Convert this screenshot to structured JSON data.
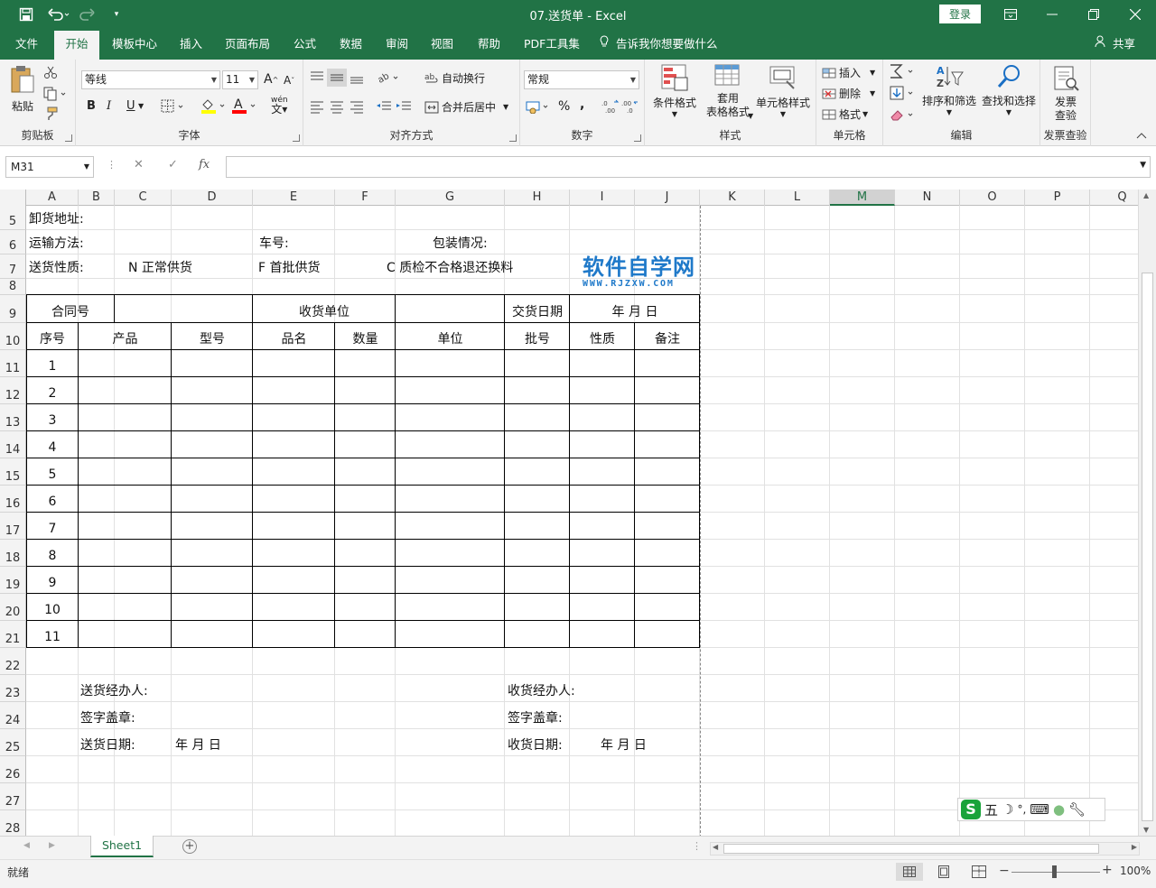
{
  "titlebar": {
    "title": "07.送货单  -  Excel",
    "login_label": "登录"
  },
  "menu": {
    "tabs": [
      "文件",
      "开始",
      "模板中心",
      "插入",
      "页面布局",
      "公式",
      "数据",
      "审阅",
      "视图",
      "帮助",
      "PDF工具集"
    ],
    "active_tab": "开始",
    "tellme": "告诉我你想要做什么",
    "share": "共享"
  },
  "ribbon": {
    "clipboard": {
      "label": "剪贴板",
      "paste": "粘贴"
    },
    "font": {
      "label": "字体",
      "name": "等线",
      "size": "11",
      "bold": "B",
      "italic": "I",
      "underline": "U",
      "wen": "wén"
    },
    "alignment": {
      "label": "对齐方式",
      "wrap": "自动换行",
      "merge": "合并后居中"
    },
    "number": {
      "label": "数字",
      "format": "常规",
      "percent": "%",
      "comma": ","
    },
    "styles": {
      "label": "样式",
      "cond": "条件格式",
      "table_line1": "套用",
      "table_line2": "表格格式",
      "cell": "单元格样式"
    },
    "cells": {
      "label": "单元格",
      "insert": "插入",
      "delete": "删除",
      "format": "格式"
    },
    "editing": {
      "label": "编辑",
      "sort": "排序和筛选",
      "find": "查找和选择"
    },
    "invoice": {
      "label": "发票查验",
      "line1": "发票",
      "line2": "查验"
    }
  },
  "formula": {
    "namebox": "M31",
    "value": ""
  },
  "grid": {
    "columns": [
      "A",
      "B",
      "C",
      "D",
      "E",
      "F",
      "G",
      "H",
      "I",
      "J",
      "K",
      "L",
      "M",
      "N",
      "O",
      "P",
      "Q"
    ],
    "selected_column": "M",
    "rows": [
      "5",
      "6",
      "7",
      "8",
      "9",
      "10",
      "11",
      "12",
      "13",
      "14",
      "15",
      "16",
      "17",
      "18",
      "19",
      "20",
      "21",
      "22",
      "23",
      "24",
      "25",
      "26",
      "27",
      "28"
    ],
    "cells": {
      "unload_address": "卸货地址:",
      "transport": "运输方法:",
      "car_no": "车号:",
      "packing": "包装情况:",
      "nature": "送货性质:",
      "opt_n": "N 正常供货",
      "opt_f": "F  首批供货",
      "opt_c": "C  质检不合格退还换料",
      "contract_no": "合同号",
      "receiver": "收货单位",
      "delivery_date": "交货日期",
      "date_ymd": "年     月     日",
      "headers": [
        "序号",
        "产品",
        "型号",
        "品名",
        "数量",
        "单位",
        "批号",
        "性质",
        "备注"
      ],
      "serials": [
        "1",
        "2",
        "3",
        "4",
        "5",
        "6",
        "7",
        "8",
        "9",
        "10",
        "11"
      ],
      "sender_agent": "送货经办人:",
      "sender_sign": "签字盖章:",
      "send_date": "送货日期:",
      "send_ymd": "年      月      日",
      "recv_agent": "收货经办人:",
      "recv_sign": "签字盖章:",
      "recv_date": "收货日期:",
      "recv_ymd": "年      月      日"
    }
  },
  "watermark": {
    "title": "软件自学网",
    "sub": "WWW.RJZXW.COM"
  },
  "ime": {
    "mode": "五"
  },
  "sheets": {
    "tabs": [
      "Sheet1"
    ],
    "active": "Sheet1"
  },
  "status": {
    "ready": "就绪",
    "zoom": "100%"
  },
  "colors": {
    "brand": "#217346",
    "watermark": "#1f79c9"
  }
}
